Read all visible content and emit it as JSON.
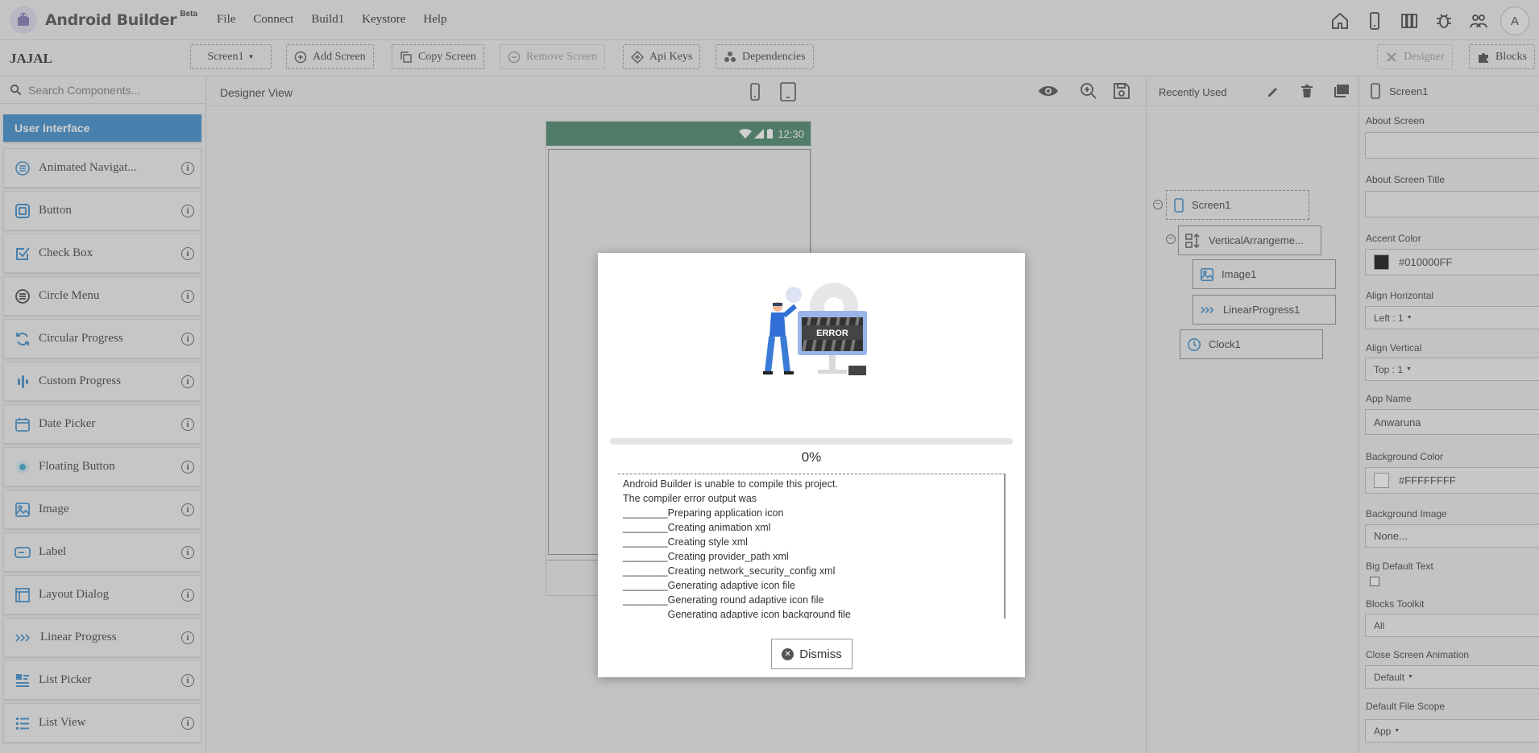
{
  "app": {
    "title": "Android Builder",
    "beta": "Beta",
    "avatar": "A"
  },
  "menu": [
    "File",
    "Connect",
    "Build1",
    "Keystore",
    "Help"
  ],
  "top_icons": [
    "home-icon",
    "phone-icon",
    "library-icon",
    "bug-icon",
    "users-icon"
  ],
  "toolbar": {
    "project": "JAJAL",
    "screen_select": "Screen1",
    "add_screen": "Add Screen",
    "copy_screen": "Copy Screen",
    "remove_screen": "Remove Screen",
    "api_keys": "Api Keys",
    "dependencies": "Dependencies",
    "designer": "Designer",
    "blocks": "Blocks"
  },
  "palette": {
    "search_placeholder": "Search Components...",
    "category": "User Interface",
    "items": [
      {
        "label": "Animated Navigat...",
        "icon": "menu-list-icon"
      },
      {
        "label": "Button",
        "icon": "button-icon"
      },
      {
        "label": "Check Box",
        "icon": "checkbox-icon"
      },
      {
        "label": "Circle Menu",
        "icon": "circle-menu-icon"
      },
      {
        "label": "Circular Progress",
        "icon": "refresh-icon"
      },
      {
        "label": "Custom Progress",
        "icon": "bars-icon"
      },
      {
        "label": "Date Picker",
        "icon": "calendar-icon"
      },
      {
        "label": "Floating Button",
        "icon": "fab-icon"
      },
      {
        "label": "Image",
        "icon": "image-icon"
      },
      {
        "label": "Label",
        "icon": "label-icon"
      },
      {
        "label": "Layout Dialog",
        "icon": "dialog-icon"
      },
      {
        "label": "Linear Progress",
        "icon": "chevrons-icon"
      },
      {
        "label": "List Picker",
        "icon": "list-picker-icon"
      },
      {
        "label": "List View",
        "icon": "list-view-icon"
      }
    ]
  },
  "designer": {
    "title": "Designer View",
    "status_time": "12:30"
  },
  "tree": {
    "title": "Recently Used",
    "nodes": [
      "Screen1",
      "VerticalArrangeme...",
      "Image1",
      "LinearProgress1",
      "Clock1"
    ]
  },
  "properties": {
    "component": "Screen1",
    "about_screen": "About Screen",
    "about_screen_title": "About Screen Title",
    "accent_color": "Accent Color",
    "accent_color_value": "#010000FF",
    "accent_color_hex": "#010000",
    "align_horizontal": "Align Horizontal",
    "align_horizontal_value": "Left : 1",
    "align_vertical": "Align Vertical",
    "align_vertical_value": "Top : 1",
    "app_name": "App Name",
    "app_name_value": "Anwaruna",
    "background_color": "Background Color",
    "background_color_value": "#FFFFFFFF",
    "background_image": "Background Image",
    "background_image_value": "None...",
    "big_default_text": "Big Default Text",
    "blocks_toolkit": "Blocks Toolkit",
    "blocks_toolkit_value": "All",
    "close_screen_animation": "Close Screen Animation",
    "close_screen_animation_value": "Default",
    "default_file_scope": "Default File Scope",
    "default_file_scope_value": "App"
  },
  "modal": {
    "error_label": "ERROR",
    "progress": 0,
    "progress_text": "0%",
    "log_lines": [
      "Android Builder is unable to compile this project.",
      "The compiler error output was",
      "________Preparing application icon",
      "________Creating animation xml",
      "________Creating style xml",
      "________Creating provider_path xml",
      "________Creating network_security_config xml",
      "________Generating adaptive icon file",
      "________Generating round adaptive icon file",
      "________Generating adaptive icon background file"
    ],
    "dismiss": "Dismiss"
  }
}
